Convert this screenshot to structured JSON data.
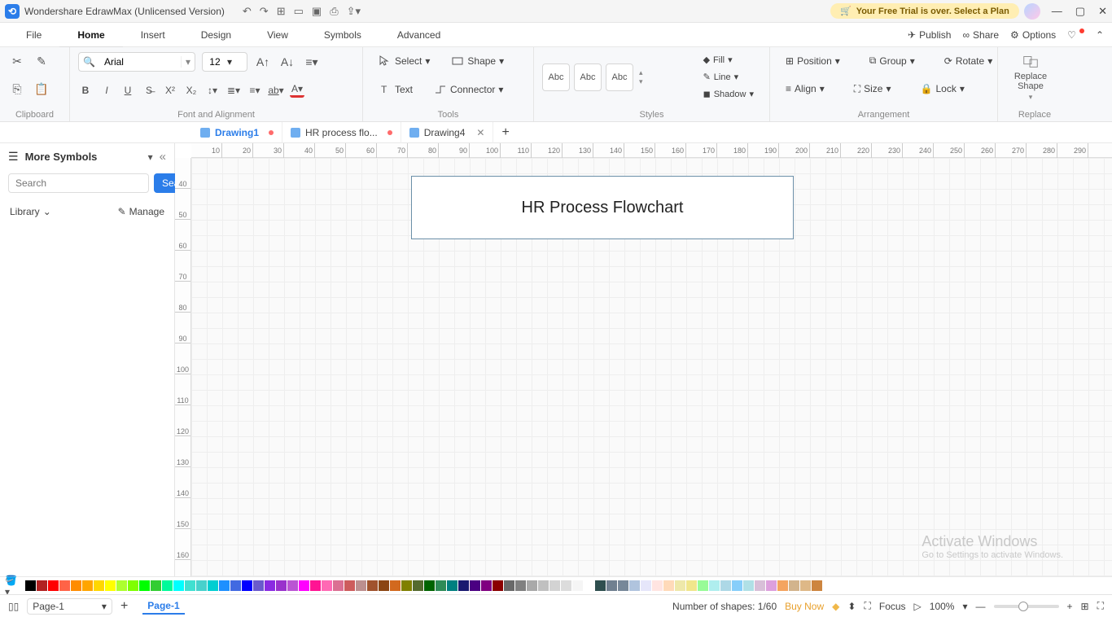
{
  "app": {
    "title": "Wondershare EdrawMax (Unlicensed Version)"
  },
  "trial": {
    "text": "Your Free Trial is over. Select a Plan"
  },
  "menu": {
    "items": [
      "File",
      "Home",
      "Insert",
      "Design",
      "View",
      "Symbols",
      "Advanced"
    ],
    "active": "Home",
    "right": {
      "publish": "Publish",
      "share": "Share",
      "options": "Options"
    }
  },
  "ribbon": {
    "clipboard": {
      "label": "Clipboard"
    },
    "font": {
      "name": "Arial",
      "size": "12",
      "label": "Font and Alignment"
    },
    "tools": {
      "select": "Select",
      "shape": "Shape",
      "text": "Text",
      "connector": "Connector",
      "label": "Tools"
    },
    "styles": {
      "abc": "Abc",
      "label": "Styles",
      "fill": "Fill",
      "line": "Line",
      "shadow": "Shadow"
    },
    "arrange": {
      "position": "Position",
      "group": "Group",
      "rotate": "Rotate",
      "align": "Align",
      "size": "Size",
      "lock": "Lock",
      "label": "Arrangement"
    },
    "replace": {
      "btn": "Replace\nShape",
      "label": "Replace"
    }
  },
  "doctabs": [
    {
      "name": "Drawing1",
      "modified": true,
      "active": true
    },
    {
      "name": "HR process flo...",
      "modified": true,
      "active": false
    },
    {
      "name": "Drawing4",
      "modified": false,
      "active": false,
      "closable": true
    }
  ],
  "sidebar": {
    "title": "More Symbols",
    "search_ph": "Search",
    "search_btn": "Search",
    "library": "Library",
    "manage": "Manage"
  },
  "canvas": {
    "title_shape": "HR Process Flowchart"
  },
  "rulerH": [
    "10",
    "20",
    "30",
    "40",
    "50",
    "60",
    "70",
    "80",
    "90",
    "100",
    "110",
    "120",
    "130",
    "140",
    "150",
    "160",
    "170",
    "180",
    "190",
    "200",
    "210",
    "220",
    "230",
    "240",
    "250",
    "260",
    "270",
    "280",
    "290"
  ],
  "rulerV": [
    "40",
    "50",
    "60",
    "70",
    "80",
    "90",
    "100",
    "110",
    "120",
    "130",
    "140",
    "150",
    "160"
  ],
  "palette": [
    "#000000",
    "#b22222",
    "#ff0000",
    "#ff6347",
    "#ff8c00",
    "#ffa500",
    "#ffd700",
    "#ffff00",
    "#adff2f",
    "#7fff00",
    "#00ff00",
    "#32cd32",
    "#00fa9a",
    "#00ffff",
    "#40e0d0",
    "#48d1cc",
    "#00ced1",
    "#1e90ff",
    "#4169e1",
    "#0000ff",
    "#6a5acd",
    "#8a2be2",
    "#9932cc",
    "#ba55d3",
    "#ff00ff",
    "#ff1493",
    "#ff69b4",
    "#db7093",
    "#cd5c5c",
    "#bc8f8f",
    "#a0522d",
    "#8b4513",
    "#d2691e",
    "#808000",
    "#556b2f",
    "#006400",
    "#2e8b57",
    "#008080",
    "#191970",
    "#4b0082",
    "#800080",
    "#8b0000",
    "#696969",
    "#808080",
    "#a9a9a9",
    "#c0c0c0",
    "#d3d3d3",
    "#dcdcdc",
    "#f5f5f5",
    "#ffffff",
    "#2f4f4f",
    "#708090",
    "#778899",
    "#b0c4de",
    "#e6e6fa",
    "#ffe4e1",
    "#ffdab9",
    "#eee8aa",
    "#f0e68c",
    "#98fb98",
    "#afeeee",
    "#add8e6",
    "#87cefa",
    "#b0e0e6",
    "#d8bfd8",
    "#dda0dd",
    "#f4a460",
    "#d2b48c",
    "#deb887",
    "#cd853f"
  ],
  "status": {
    "page": "Page-1",
    "pagetab": "Page-1",
    "shapes": "Number of shapes: 1/60",
    "buy": "Buy Now",
    "focus": "Focus",
    "zoom": "100%"
  },
  "watermark": {
    "l1": "Activate Windows",
    "l2": "Go to Settings to activate Windows."
  }
}
